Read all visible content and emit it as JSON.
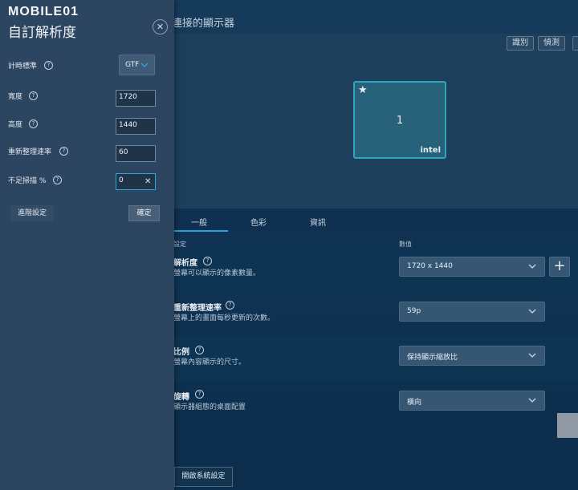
{
  "logo": {
    "text": "MOBILE01"
  },
  "window": {
    "title": "連接的顯示器"
  },
  "preview": {
    "identify_label": "識別",
    "detect_label": "偵測",
    "extra_label": "",
    "monitor": {
      "star": "★",
      "number": "1",
      "brand": "intel"
    }
  },
  "tabs": [
    {
      "label": "一般"
    },
    {
      "label": "色彩"
    },
    {
      "label": "資訊"
    }
  ],
  "columns": {
    "setting": "設定",
    "value": "數值"
  },
  "settings": [
    {
      "title": "解析度",
      "desc": "螢幕可以顯示的像素數量。",
      "value": "1720 x 1440"
    },
    {
      "title": "重新整理速率",
      "desc": "螢幕上的畫面每秒更新的次數。",
      "value": "59p"
    },
    {
      "title": "比例",
      "desc": "螢幕內容顯示的尺寸。",
      "value": "保持顯示縮放比"
    },
    {
      "title": "旋轉",
      "desc": "顯示器組態的桌面配置",
      "value": "橫向"
    }
  ],
  "add_label": "+",
  "system_settings_label": "開啟系統設定",
  "dialog": {
    "title": "自訂解析度",
    "close_label": "✕",
    "help_glyph": "?",
    "fields": {
      "timing": {
        "label": "計時標準",
        "value": "GTF"
      },
      "width": {
        "label": "寬度",
        "value": "1720"
      },
      "height": {
        "label": "高度",
        "value": "1440"
      },
      "refresh": {
        "label": "重新整理速率",
        "value": "60"
      },
      "underscan": {
        "label": "不足掃描 %",
        "value": "0"
      }
    },
    "clear_label": "✕",
    "advanced_label": "進階設定",
    "ok_label": "確定"
  },
  "colors": {
    "accent": "#2fa6d6",
    "dialog_bg": "#2c4560",
    "main_bg": "#0f3253"
  }
}
